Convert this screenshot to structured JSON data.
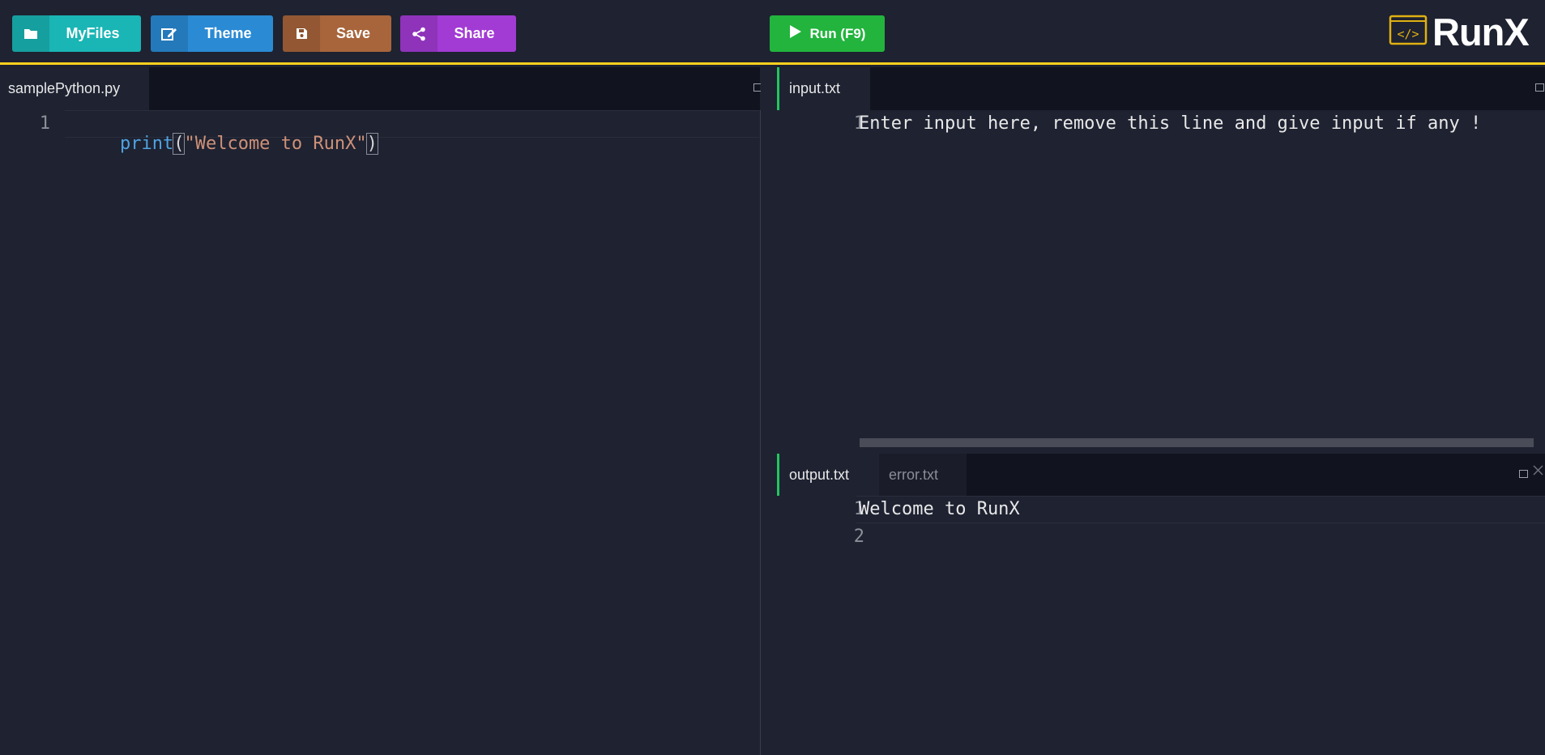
{
  "toolbar": {
    "myfiles_label": "MyFiles",
    "theme_label": "Theme",
    "save_label": "Save",
    "share_label": "Share",
    "run_label": "Run (F9)"
  },
  "brand": {
    "logo_glyph": "</>",
    "name": "RunX"
  },
  "editor": {
    "tab_label": "samplePython.py",
    "lines": [
      {
        "number": "1",
        "fn": "print",
        "open": "(",
        "string": "\"Welcome to RunX\"",
        "close": ")"
      }
    ]
  },
  "input": {
    "tab_label": "input.txt",
    "lines": [
      {
        "number": "1",
        "text": "Enter input here, remove this line and give input if any !"
      }
    ]
  },
  "output": {
    "tabs": [
      {
        "label": "output.txt",
        "active": true
      },
      {
        "label": "error.txt",
        "active": false
      }
    ],
    "lines": [
      {
        "number": "1",
        "text": "Welcome to RunX"
      },
      {
        "number": "2",
        "text": ""
      }
    ]
  },
  "colors": {
    "accent_yellow": "#ffd21e",
    "myfiles": "#1ab5b5",
    "theme": "#2a8ad4",
    "save": "#a8653b",
    "share": "#a23bd4",
    "run": "#22b43d",
    "active_tab_marker": "#22c55e"
  },
  "icons": {
    "myfiles": "folder-icon",
    "theme": "edit-icon",
    "save": "floppy-disk-icon",
    "share": "share-icon",
    "run": "play-icon",
    "maximize": "maximize-icon",
    "close": "close-icon"
  }
}
